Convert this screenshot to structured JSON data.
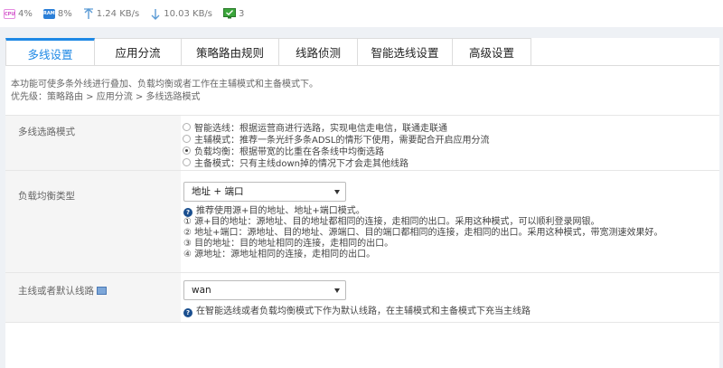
{
  "status": {
    "cpu_icon": "CPU",
    "cpu": "4%",
    "ram_icon": "RAM",
    "ram": "8%",
    "up": "1.24 KB/s",
    "down": "10.03 KB/s",
    "online": "3"
  },
  "tabs": [
    {
      "label": "多线设置"
    },
    {
      "label": "应用分流"
    },
    {
      "label": "策略路由规则"
    },
    {
      "label": "线路侦测"
    },
    {
      "label": "智能选线设置"
    },
    {
      "label": "高级设置"
    }
  ],
  "description": {
    "line1": "本功能可使多条外线进行叠加、负载均衡或者工作在主辅模式和主备模式下。",
    "line2": "优先级：策略路由 > 应用分流 > 多线选路模式"
  },
  "mode": {
    "label": "多线选路模式",
    "options": [
      "智能选线：根据运营商进行选路，实现电信走电信，联通走联通",
      "主辅模式：推荐一条光纤多条ADSL的情形下使用，需要配合开启应用分流",
      "负载均衡：根据带宽的比重在各条线中均衡选路",
      "主备模式：只有主线down掉的情况下才会走其他线路"
    ],
    "selected_index": 2
  },
  "balance": {
    "label": "负载均衡类型",
    "value": "地址 + 端口",
    "help": [
      "推荐使用源+目的地址、地址+端口模式。",
      "① 源+目的地址：源地址、目的地址都相同的连接，走相同的出口。采用这种模式，可以顺利登录网银。",
      "② 地址+端口：源地址、目的地址、源端口、目的端口都相同的连接，走相同的出口。采用这种模式，带宽测速效果好。",
      "③ 目的地址：目的地址相同的连接，走相同的出口。",
      "④ 源地址：源地址相同的连接，走相同的出口。"
    ]
  },
  "default_line": {
    "label": "主线或者默认线路",
    "value": "wan",
    "help": "在智能选线或者负载均衡模式下作为默认线路，在主辅模式和主备模式下充当主线路"
  },
  "colors": {
    "accent": "#1e88e5"
  }
}
